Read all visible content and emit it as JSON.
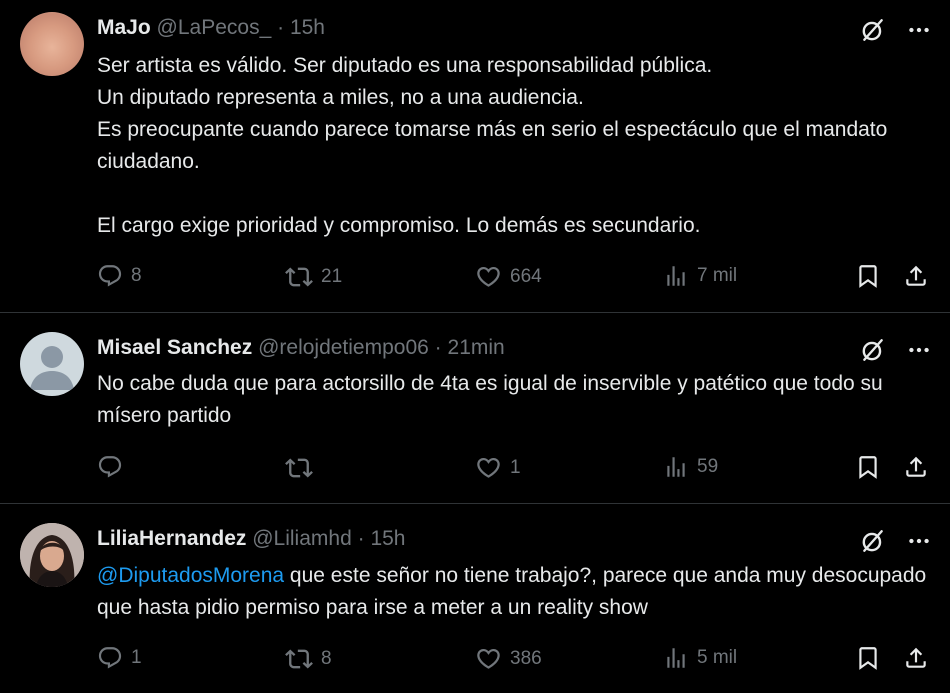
{
  "tweets": [
    {
      "name": "MaJo",
      "handle": "@LaPecos_",
      "dot": "·",
      "time": "15h",
      "body": "Ser artista es válido. Ser diputado es una responsabilidad pública.\nUn diputado representa a miles, no a una audiencia.\nEs preocupante cuando parece tomarse más en serio el espectáculo que el mandato ciudadano.\n\nEl cargo exige prioridad y compromiso. Lo demás es secundario.",
      "replies": "8",
      "reposts": "21",
      "likes": "664",
      "views": "7 mil"
    },
    {
      "name": "Misael Sanchez",
      "handle": "@relojdetiempo06",
      "dot": "·",
      "time": "21min",
      "body": "No cabe duda que para actorsillo de 4ta es igual de inservible y patético que todo su mísero partido",
      "replies": "",
      "reposts": "",
      "likes": "1",
      "views": "59"
    },
    {
      "name": "LiliaHernandez",
      "handle": "@Liliamhd",
      "dot": "·",
      "time": "15h",
      "mention": "@DiputadosMorena",
      "body": " que este señor no tiene trabajo?, parece que anda muy desocupado que hasta pidio permiso para irse a meter a un reality show",
      "replies": "1",
      "reposts": "8",
      "likes": "386",
      "views": "5 mil"
    }
  ],
  "icons": {
    "grok": "grok-icon",
    "more": "more-icon",
    "reply": "reply-icon",
    "repost": "repost-icon",
    "like": "heart-icon",
    "views": "views-icon",
    "bookmark": "bookmark-icon",
    "share": "share-icon"
  },
  "colors": {
    "background": "#000000",
    "text": "#e7e9ea",
    "muted": "#71767b",
    "link": "#1d9bf0",
    "divider": "#2f3336"
  }
}
